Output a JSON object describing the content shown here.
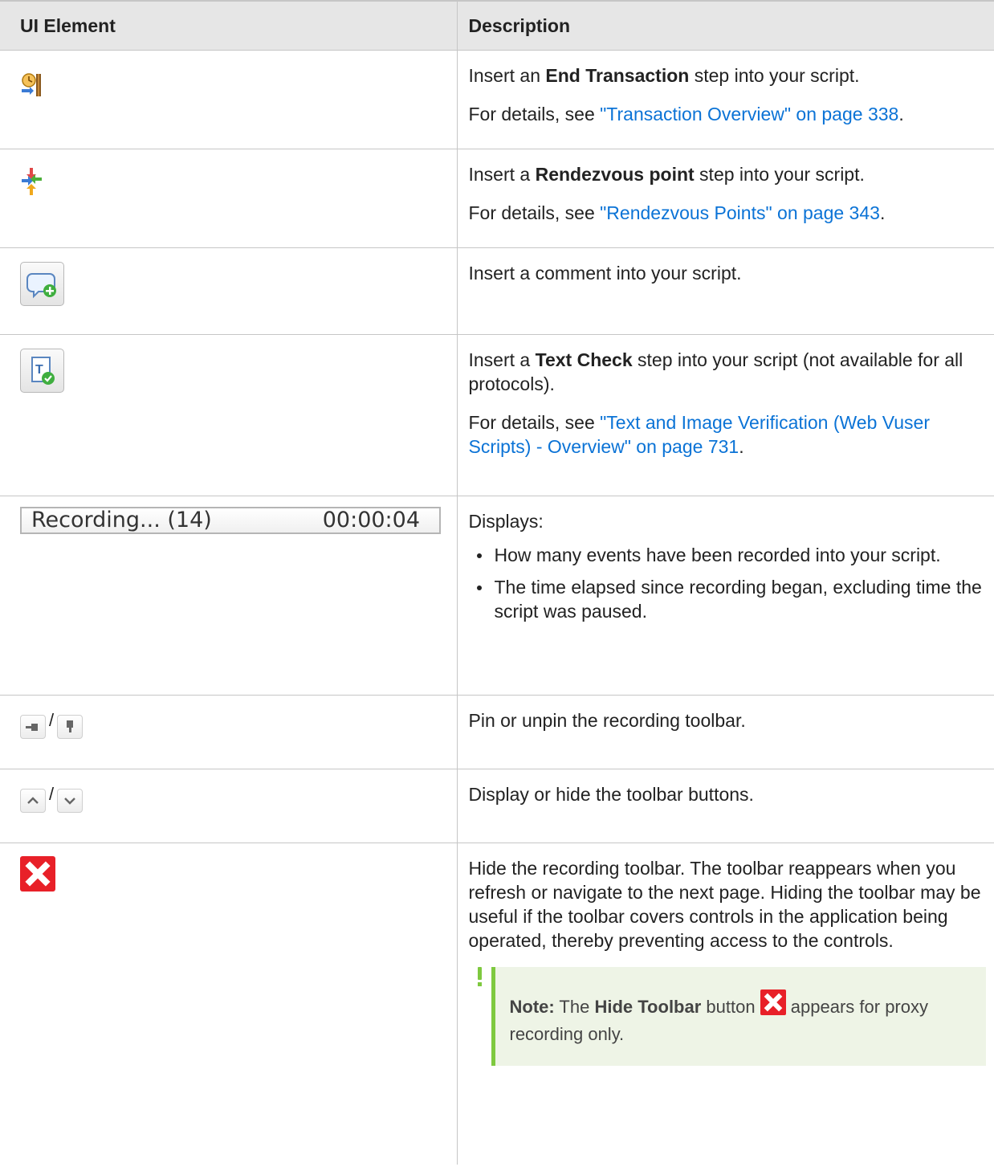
{
  "table": {
    "header": {
      "col1": "UI Element",
      "col2": "Description"
    },
    "rows": [
      {
        "icon": "end-transaction-icon",
        "desc": {
          "pre": "Insert an ",
          "bold": "End Transaction",
          "post": " step into your script.",
          "details_prefix": "For details, see ",
          "link": "\"Transaction Overview\" on page 338",
          "details_suffix": "."
        }
      },
      {
        "icon": "rendezvous-point-icon",
        "desc": {
          "pre": "Insert a ",
          "bold": "Rendezvous point",
          "post": " step into your script.",
          "details_prefix": "For details, see ",
          "link": "\"Rendezvous Points\" on page 343",
          "details_suffix": "."
        }
      },
      {
        "icon": "insert-comment-icon",
        "desc": {
          "text": "Insert a comment into your script."
        }
      },
      {
        "icon": "text-check-icon",
        "desc": {
          "pre": "Insert a ",
          "bold": "Text Check",
          "post": " step into your script (not available for all protocols).",
          "details_prefix": "For details, see ",
          "link": "\"Text and Image Verification (Web Vuser Scripts) - Overview\" on page 731",
          "details_suffix": "."
        }
      },
      {
        "recording": {
          "label": "Recording... (14)",
          "time": "00:00:04"
        },
        "desc": {
          "title": "Displays:",
          "bullets": [
            "How many events have been recorded into your script.",
            "The time elapsed since recording began, excluding time the script was paused."
          ]
        }
      },
      {
        "icon": "pin-icon",
        "icon2": "unpin-icon",
        "separator": "/",
        "desc": {
          "text": "Pin or unpin the recording toolbar."
        }
      },
      {
        "icon": "chevron-up-icon",
        "icon2": "chevron-down-icon",
        "separator": "/",
        "desc": {
          "text": "Display or hide the toolbar buttons."
        }
      },
      {
        "icon": "close-icon",
        "desc": {
          "text": "Hide the recording toolbar. The toolbar reappears when you refresh or navigate to the next page. Hiding the toolbar may be useful if the toolbar covers controls in the application being operated, thereby preventing access to the controls.",
          "note": {
            "label": "Note:",
            "pre": " The ",
            "bold": "Hide Toolbar",
            "mid": " button ",
            "post": " appears for proxy recording only."
          }
        }
      }
    ]
  }
}
